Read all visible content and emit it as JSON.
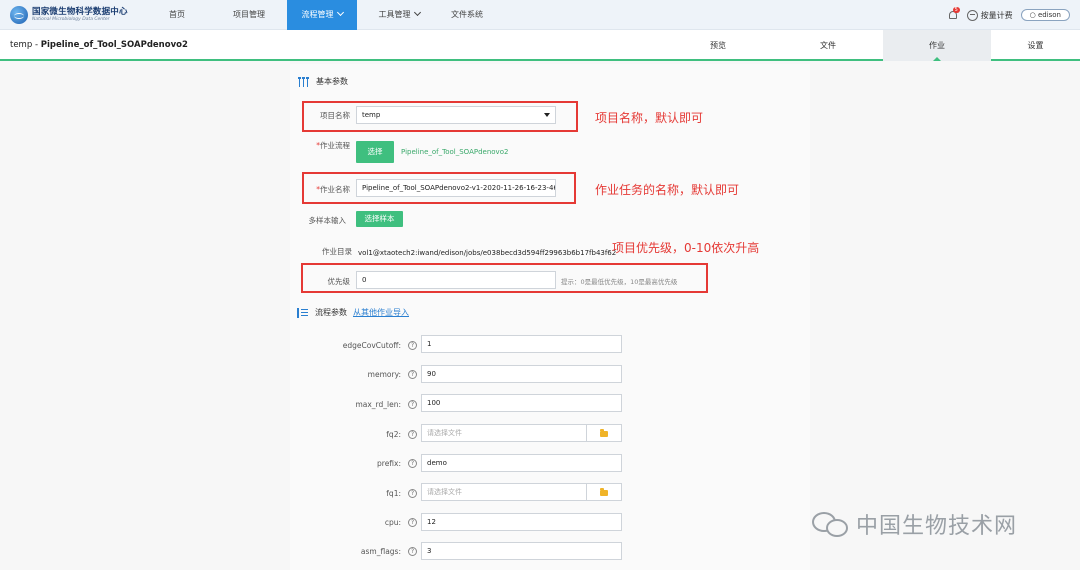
{
  "topnav": {
    "logo_cn": "国家微生物科学数据中心",
    "logo_en": "National Microbiology Data Center",
    "items": [
      {
        "label": "首页"
      },
      {
        "label": "项目管理"
      },
      {
        "label": "流程管理"
      },
      {
        "label": "工具管理"
      },
      {
        "label": "文件系统"
      }
    ],
    "notification_count": "5",
    "pay_label": "按量计费",
    "user": "edison"
  },
  "subheader": {
    "title_prefix": "temp - ",
    "title_name": "Pipeline_of_Tool_SOAPdenovo2",
    "tabs": [
      {
        "label": "预览"
      },
      {
        "label": "文件"
      },
      {
        "label": "作业"
      },
      {
        "label": "设置"
      }
    ]
  },
  "basic": {
    "section_title": "基本参数",
    "project_label": "项目名称",
    "project_value": "temp",
    "workflow_label": "作业流程",
    "workflow_button": "选择",
    "workflow_value": "Pipeline_of_Tool_SOAPdenovo2",
    "jobname_label": "作业名称",
    "jobname_value": "Pipeline_of_Tool_SOAPdenovo2-v1-2020-11-26-16-23-46",
    "multisample_label": "多样本输入",
    "multisample_button": "选择样本",
    "jobdir_label": "作业目录",
    "jobdir_value": "vol1@xtaotech2:iwand/edison/jobs/e038becd3d594ff29963b6b17fb43f62",
    "priority_label": "优先级",
    "priority_value": "0",
    "priority_hint": "提示：0是最低优先级，10是最高优先级"
  },
  "flow": {
    "section_title": "流程参数",
    "import_link": "从其他作业导入",
    "file_placeholder": "请选择文件",
    "params": [
      {
        "label": "edgeCovCutoff:",
        "value": "1"
      },
      {
        "label": "memory:",
        "value": "90"
      },
      {
        "label": "max_rd_len:",
        "value": "100"
      },
      {
        "label": "fq2:",
        "value": ""
      },
      {
        "label": "prefix:",
        "value": "demo"
      },
      {
        "label": "fq1:",
        "value": ""
      },
      {
        "label": "cpu:",
        "value": "12"
      },
      {
        "label": "asm_flags:",
        "value": "3"
      }
    ]
  },
  "annotations": {
    "project": "项目名称，默认即可",
    "jobname": "作业任务的名称，默认即可",
    "priority": "项目优先级，0-10依次升高"
  },
  "watermark": "中国生物技术网",
  "colors": {
    "accent_blue": "#2a8de0",
    "green": "#3fbf7f",
    "annotation_red": "#e53935"
  }
}
